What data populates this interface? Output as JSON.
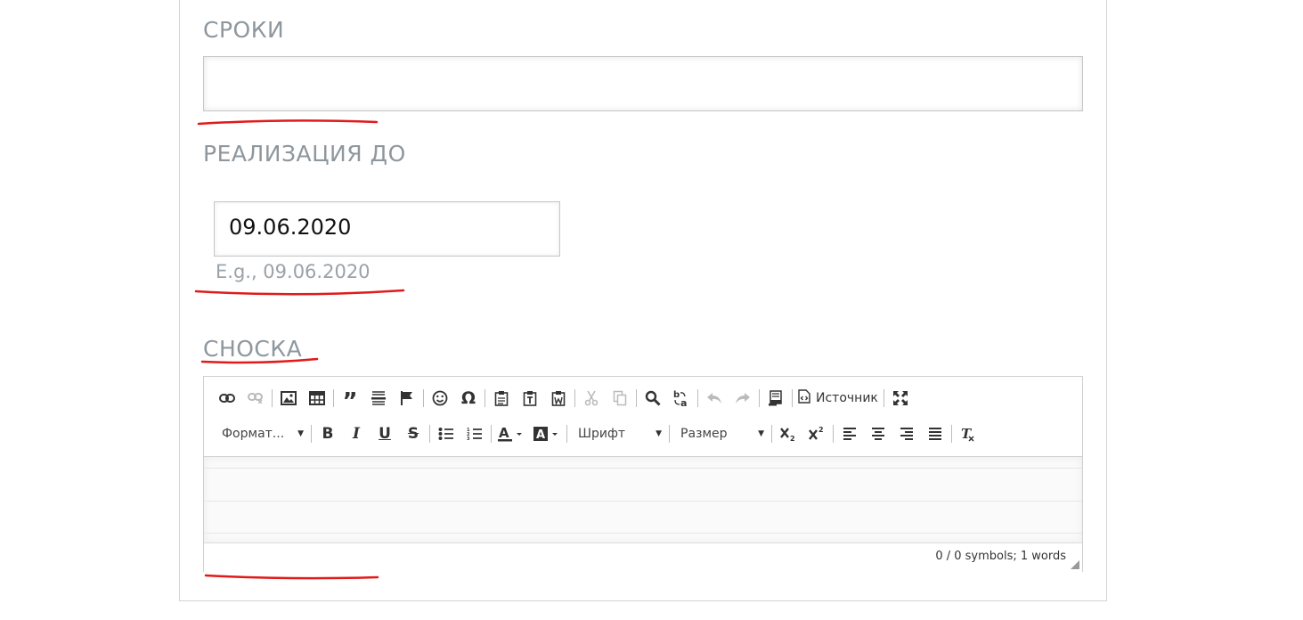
{
  "fields": {
    "sroki": {
      "label": "СРОКИ",
      "value": ""
    },
    "realization": {
      "label": "РЕАЛИЗАЦИЯ ДО",
      "value": "09.06.2020",
      "hint": "E.g., 09.06.2020"
    },
    "footnote": {
      "label": "СНОСКА"
    }
  },
  "editor": {
    "source_label": "Источник",
    "format_label": "Формат...",
    "font_label": "Шрифт",
    "size_label": "Размер",
    "counter": "0 / 0 symbols; 1 words",
    "content": ""
  },
  "colors": {
    "label": "#8e979e",
    "hint": "#9aa2a8",
    "annotation_underline": "#e11a1a",
    "border": "#c6c6c6"
  },
  "icons": {
    "row1": [
      "link-icon",
      "unlink-icon",
      "image-icon",
      "table-icon",
      "blockquote-icon",
      "horizontal-rule-icon",
      "anchor-flag-icon",
      "smiley-icon",
      "special-char-omega-icon",
      "paste-icon",
      "paste-text-icon",
      "paste-word-icon",
      "cut-icon",
      "copy-icon",
      "find-icon",
      "replace-icon",
      "undo-icon",
      "redo-icon",
      "templates-icon",
      "source-icon",
      "maximize-icon"
    ],
    "row2": [
      "bold-icon",
      "italic-icon",
      "underline-icon",
      "strikethrough-icon",
      "bulleted-list-icon",
      "numbered-list-icon",
      "text-color-icon",
      "background-color-icon",
      "subscript-icon",
      "superscript-icon",
      "align-left-icon",
      "align-center-icon",
      "align-right-icon",
      "justify-icon",
      "remove-format-icon"
    ]
  }
}
